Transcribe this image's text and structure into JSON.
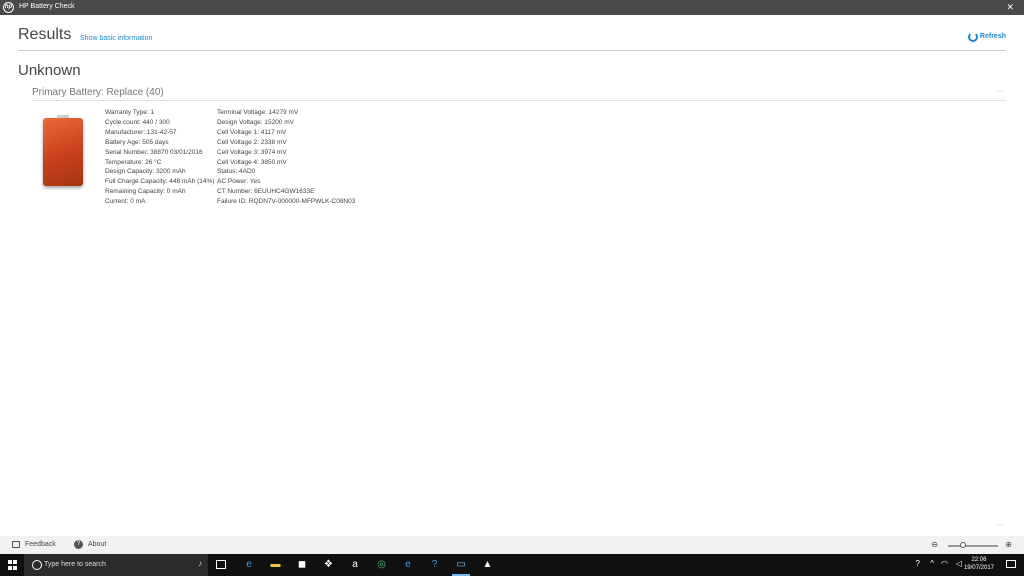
{
  "window": {
    "title": "HP Battery Check",
    "logo": "hp",
    "close_glyph": "✕"
  },
  "header": {
    "title": "Results",
    "show_basic": "Show basic information",
    "refresh": "Refresh"
  },
  "status": "Unknown",
  "battery": {
    "heading": "Primary Battery:  Replace (40)",
    "col1": [
      "Warranty Type: 1",
      "Cycle count: 440 / 300",
      "Manufacturer: 131-42-57",
      "Battery Age: 505 days",
      "Serial Number: 38870 03/01/2016",
      "Temperature: 26 °C",
      "Design Capacity: 3200 mAh",
      "Full Charge Capacity: 448 mAh (14%)",
      "Remaining Capacity: 0 mAh",
      "Current: 0 mA"
    ],
    "col2": [
      "Terminal Voltage: 14279 mV",
      "Design Voltage: 15200 mV",
      "Cell Voltage 1: 4117 mV",
      "Cell Voltage 2: 2338 mV",
      "Cell Voltage 3: 3974 mV",
      "Cell Voltage 4: 3850 mV",
      "Status: 4AD0",
      "AC Power: Yes",
      "CT Number: 6EUUHC4GW1633E",
      "Failure ID: RQDN7V-000000-MFPWLK-C08N03"
    ]
  },
  "footer": {
    "feedback": "Feedback",
    "about": "About",
    "about_glyph": "?",
    "zoom_out": "⊖",
    "zoom_in": "⊕"
  },
  "taskbar": {
    "search_placeholder": "Type here to search",
    "apps": [
      {
        "name": "edge-icon",
        "glyph": "e",
        "color": "#3b9cf0"
      },
      {
        "name": "file-explorer-icon",
        "glyph": "▬",
        "color": "#f5c342"
      },
      {
        "name": "store-icon",
        "glyph": "◼",
        "color": "#ffffff"
      },
      {
        "name": "dropbox-icon",
        "glyph": "❖",
        "color": "#ffffff"
      },
      {
        "name": "amazon-icon",
        "glyph": "a",
        "color": "#ffffff"
      },
      {
        "name": "tripadvisor-icon",
        "glyph": "◎",
        "color": "#4fc07a"
      },
      {
        "name": "edge-icon-2",
        "glyph": "e",
        "color": "#3b9cf0"
      },
      {
        "name": "help-icon",
        "glyph": "?",
        "color": "#3b9cf0"
      },
      {
        "name": "hp-battery-app-icon",
        "glyph": "▭",
        "color": "#7ec1f0"
      },
      {
        "name": "photos-icon",
        "glyph": "▲",
        "color": "#ffffff"
      }
    ],
    "clock_time": "22:06",
    "clock_date": "19/07/2017"
  }
}
